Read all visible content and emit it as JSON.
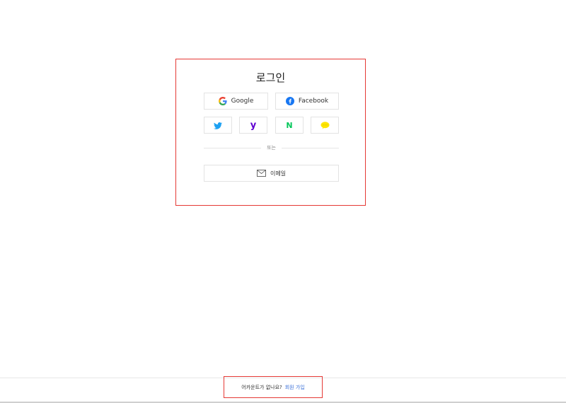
{
  "login": {
    "title": "로그인",
    "google_label": "Google",
    "facebook_label": "Facebook",
    "divider_text": "또는",
    "email_label": "이메일",
    "social_icons": [
      "twitter-icon",
      "yahoo-icon",
      "naver-icon",
      "kakao-icon"
    ]
  },
  "signup": {
    "prompt": "어카운트가 없나요?",
    "link_label": "회원 가입"
  },
  "colors": {
    "highlight_border": "#e53935",
    "link": "#3a6fd8",
    "twitter": "#1da1f2",
    "yahoo": "#5f01d1",
    "naver": "#03c75a",
    "kakao": "#fee500",
    "facebook": "#1877f2"
  }
}
